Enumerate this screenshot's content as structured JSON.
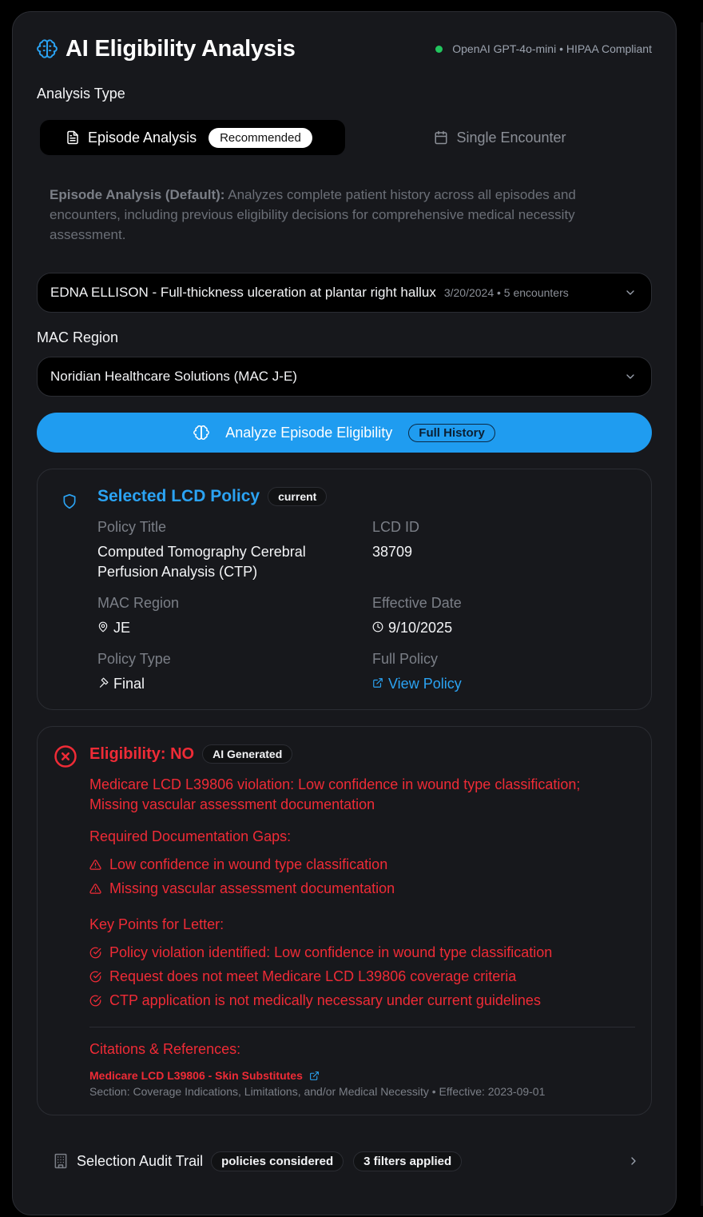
{
  "header": {
    "title": "AI Eligibility Analysis",
    "status_text": "OpenAI GPT-4o-mini • HIPAA Compliant",
    "status_color": "#22c55e",
    "icon": "brain-icon"
  },
  "analysis_type": {
    "label": "Analysis Type",
    "tabs": [
      {
        "label": "Episode Analysis",
        "badge": "Recommended",
        "active": true,
        "icon": "document-icon"
      },
      {
        "label": "Single Encounter",
        "active": false,
        "icon": "calendar-icon"
      }
    ],
    "description_bold": "Episode Analysis (Default):",
    "description": " Analyzes complete patient history across all episodes and encounters, including previous eligibility decisions for comprehensive medical necessity assessment."
  },
  "episode_select": {
    "value": "EDNA ELLISON - Full-thickness ulceration at plantar right hallux",
    "meta": "3/20/2024 • 5 encounters"
  },
  "mac_region": {
    "label": "MAC Region",
    "value": "Noridian Healthcare Solutions (MAC J-E)"
  },
  "analyze_button": {
    "label": "Analyze Episode Eligibility",
    "badge": "Full History",
    "color": "#1f9cf0"
  },
  "policy": {
    "title": "Selected LCD Policy",
    "badge": "current",
    "policy_title_label": "Policy Title",
    "policy_title": "Computed Tomography Cerebral Perfusion Analysis (CTP)",
    "lcd_id_label": "LCD ID",
    "lcd_id": "38709",
    "mac_region_label": "MAC Region",
    "mac_region": "JE",
    "effective_date_label": "Effective Date",
    "effective_date": "9/10/2025",
    "policy_type_label": "Policy Type",
    "policy_type": "Final",
    "full_policy_label": "Full Policy",
    "full_policy_link": "View Policy"
  },
  "eligibility": {
    "status": "Eligibility: NO",
    "badge": "AI Generated",
    "reason": "Medicare LCD L39806 violation: Low confidence in wound type classification; Missing vascular assessment documentation",
    "gaps_heading": "Required Documentation Gaps:",
    "gaps": [
      "Low confidence in wound type classification",
      "Missing vascular assessment documentation"
    ],
    "key_points_heading": "Key Points for Letter:",
    "key_points": [
      "Policy violation identified: Low confidence in wound type classification",
      "Request does not meet Medicare LCD L39806 coverage criteria",
      "CTP application is not medically necessary under current guidelines"
    ],
    "citations_heading": "Citations & References:",
    "citation_title": "Medicare LCD L39806 - Skin Substitutes",
    "citation_meta": "Section: Coverage Indications, Limitations, and/or Medical Necessity • Effective: 2023-09-01",
    "color": "#ef2b36"
  },
  "audit": {
    "label": "Selection Audit Trail",
    "badge1": "policies considered",
    "badge2": "3 filters applied"
  }
}
